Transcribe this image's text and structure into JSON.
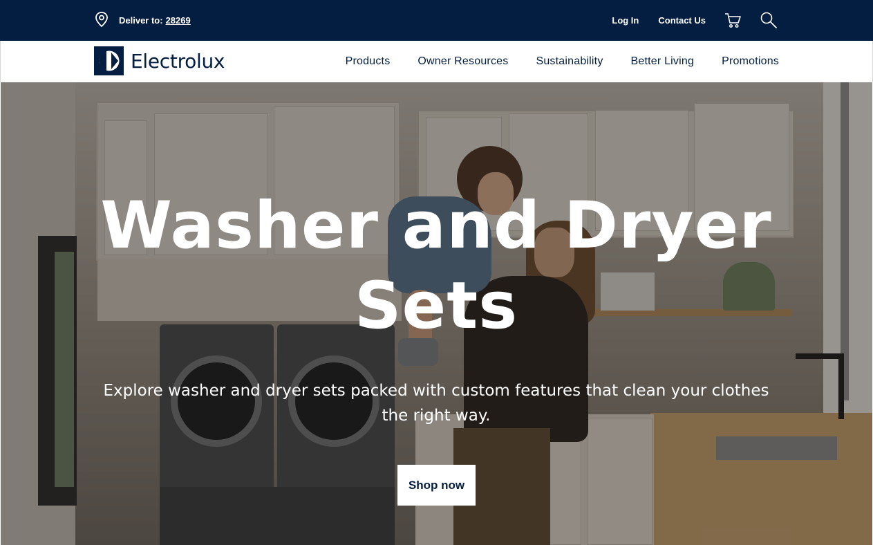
{
  "utility": {
    "deliver_label": "Deliver to:",
    "zip": "28269",
    "login": "Log In",
    "contact": "Contact Us"
  },
  "brand": {
    "name": "Electrolux",
    "color": "#041e42"
  },
  "nav": {
    "items": [
      "Products",
      "Owner Resources",
      "Sustainability",
      "Better Living",
      "Promotions"
    ]
  },
  "hero": {
    "title": "Washer and Dryer Sets",
    "subtitle": "Explore washer and dryer sets packed with custom features that clean your clothes the right way.",
    "cta": "Shop now"
  },
  "icons": {
    "location": "location-pin-icon",
    "cart": "cart-icon",
    "search": "search-icon"
  }
}
